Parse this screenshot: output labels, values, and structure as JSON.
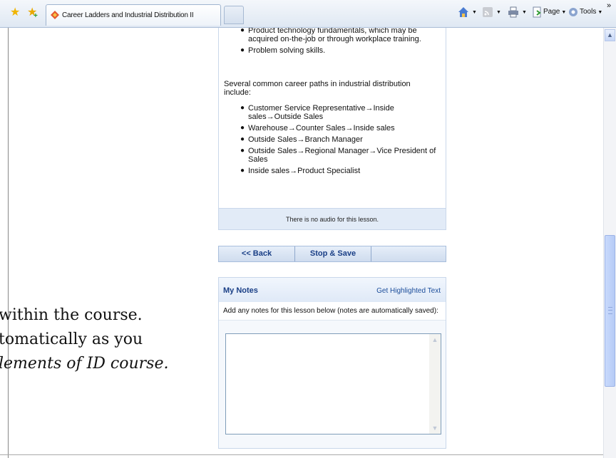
{
  "browser": {
    "tab_title": "Career Ladders and Industrial Distribution II",
    "commands": {
      "page": "Page",
      "tools": "Tools",
      "chevron": "»"
    }
  },
  "background_text": {
    "line1": "within the course.",
    "line2": "tomatically as you",
    "line3": "lements of ID course."
  },
  "lesson": {
    "top_bullets": [
      "Product technology fundamentals, which may be acquired on-the-job or through workplace training.",
      "Problem solving skills."
    ],
    "intro": "Several common career paths in industrial distribution include:",
    "paths": [
      "Customer Service Representative→Inside sales→Outside Sales",
      "Warehouse→Counter Sales→Inside sales",
      "Outside Sales→Branch Manager",
      "Outside Sales→Regional Manager→Vice President of Sales",
      "Inside sales→Product Specialist"
    ],
    "audio_note": "There is no audio for this lesson."
  },
  "navigation": {
    "back_label": "<< Back",
    "stop_save_label": "Stop & Save"
  },
  "notes": {
    "title": "My Notes",
    "highlight_link": "Get Highlighted Text",
    "help_text": "Add any notes for this lesson below (notes are automatically saved):",
    "value": ""
  },
  "colors": {
    "accent": "#1a3f86",
    "panel_border": "#c9d7ea",
    "panel_bg": "#e2ebf7"
  }
}
